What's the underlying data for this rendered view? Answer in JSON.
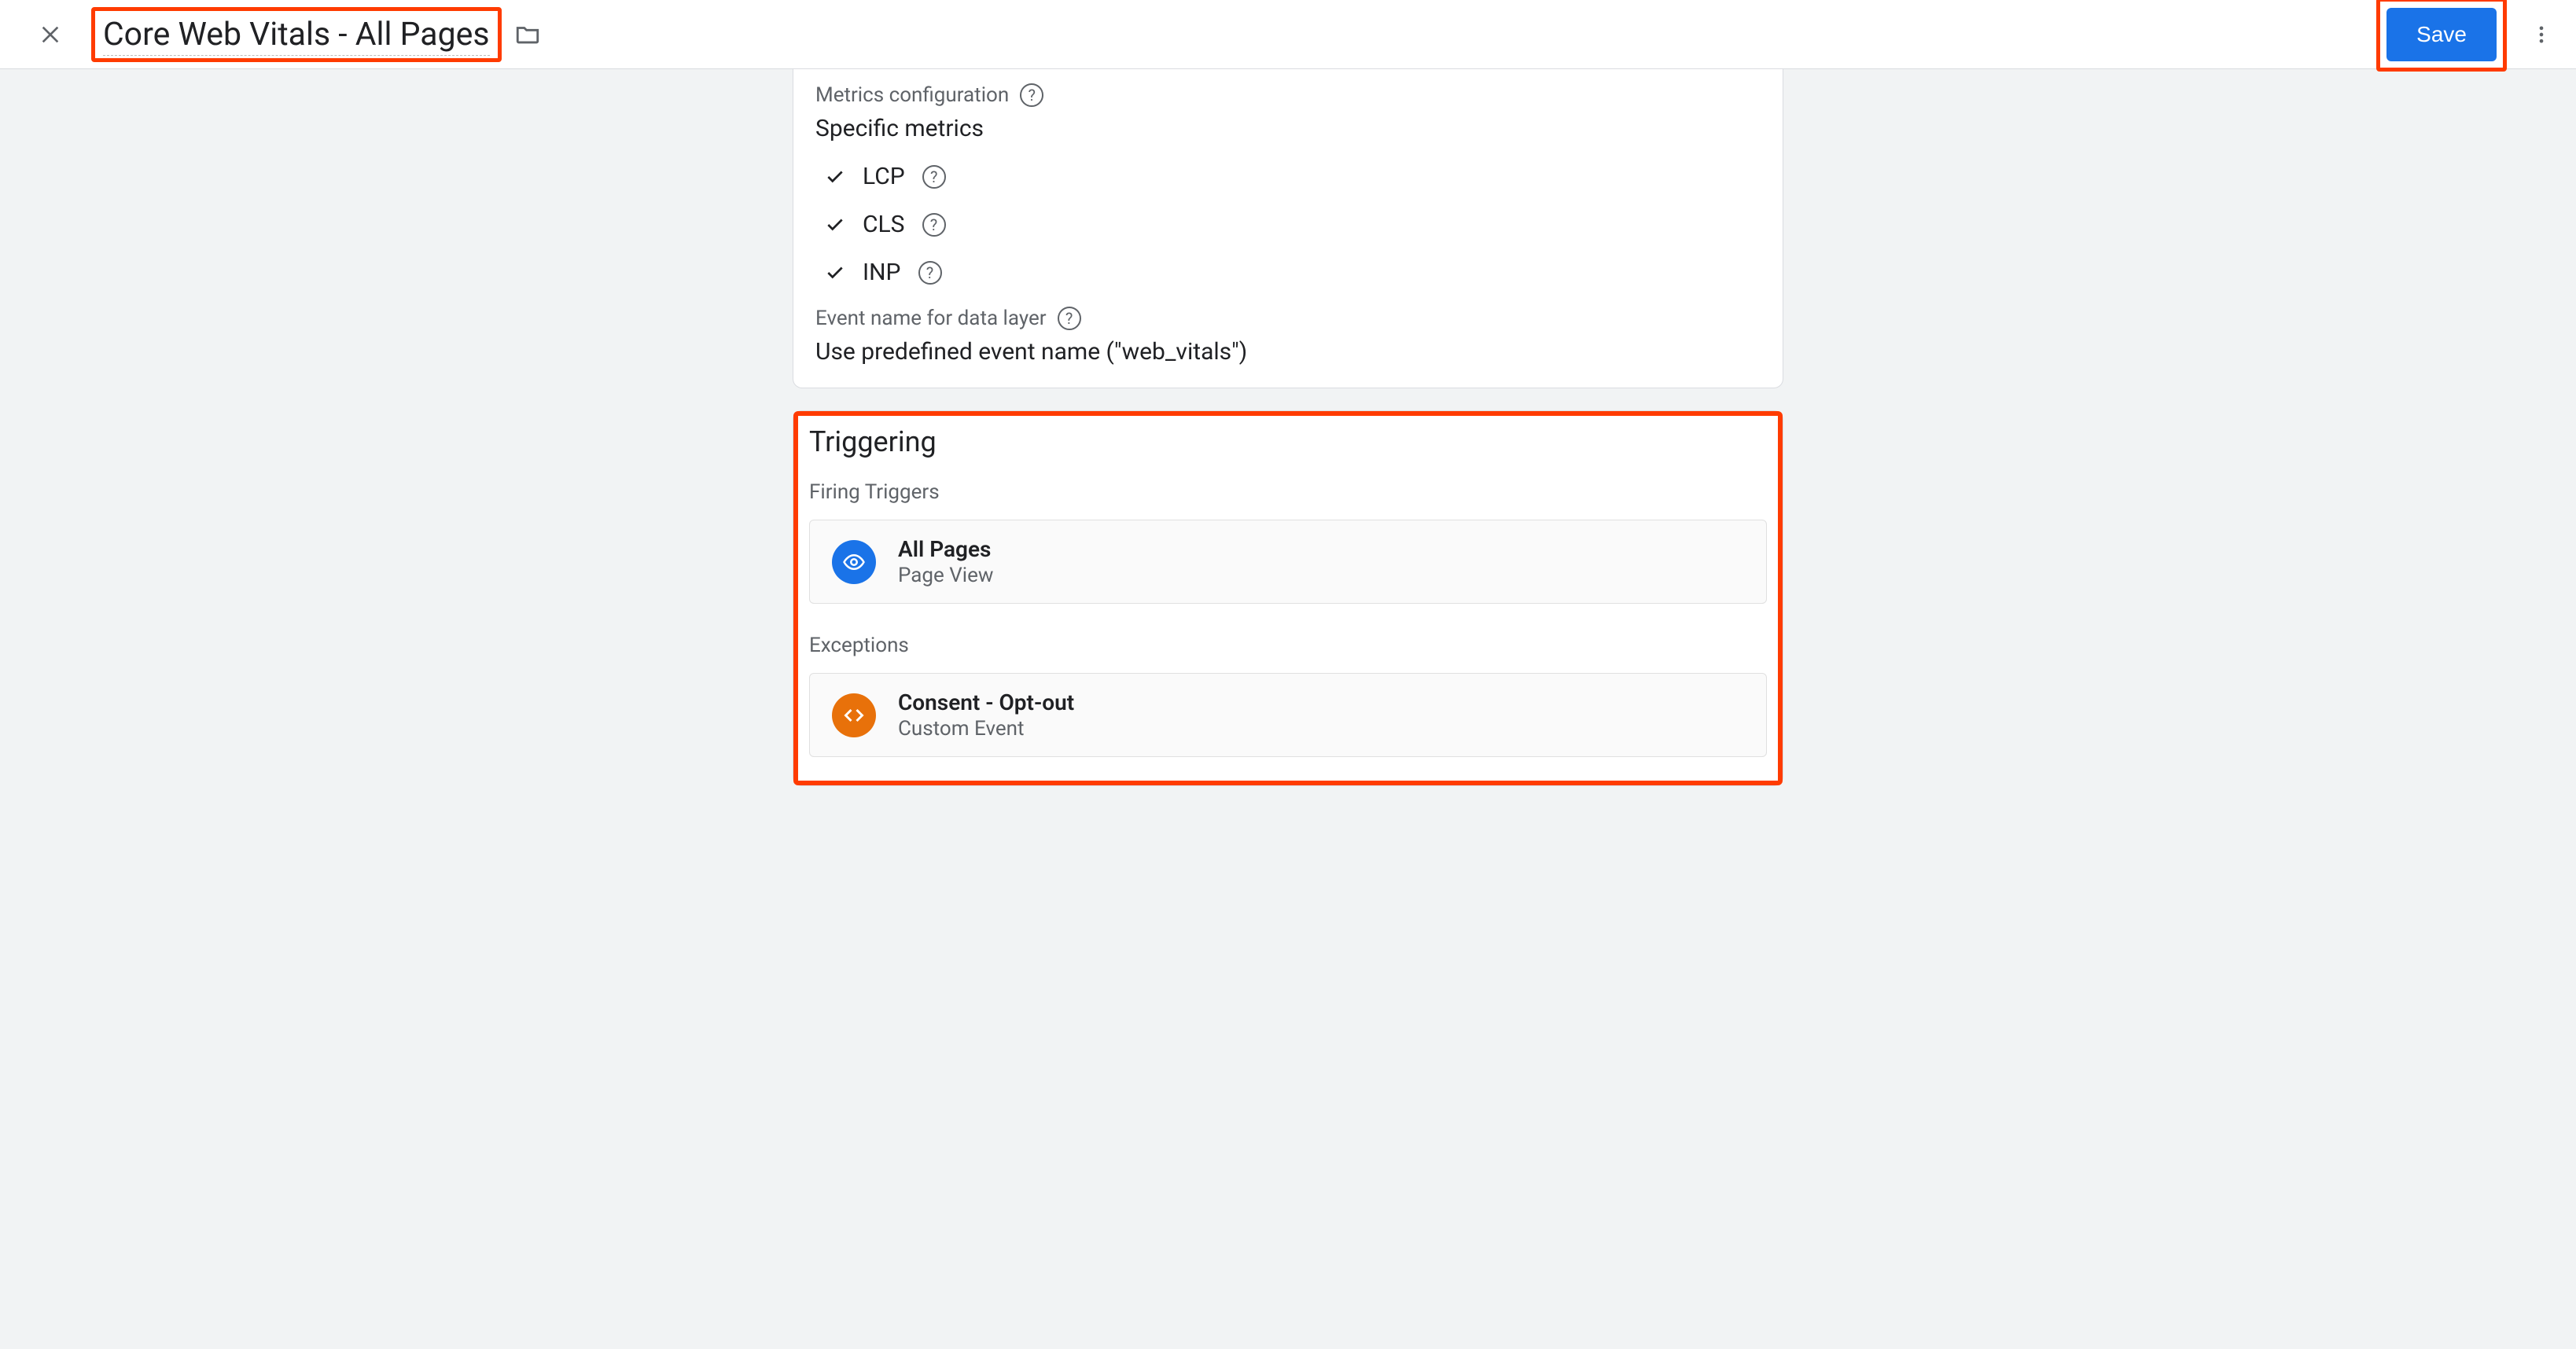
{
  "header": {
    "title": "Core Web Vitals - All Pages",
    "save_label": "Save"
  },
  "config": {
    "metrics_config_label": "Metrics configuration",
    "specific_metrics_label": "Specific metrics",
    "metrics": [
      {
        "name": "LCP"
      },
      {
        "name": "CLS"
      },
      {
        "name": "INP"
      }
    ],
    "event_name_label": "Event name for data layer",
    "event_name_value": "Use predefined event name (\"web_vitals\")"
  },
  "triggering": {
    "heading": "Triggering",
    "firing_label": "Firing Triggers",
    "firing": [
      {
        "name": "All Pages",
        "type": "Page View"
      }
    ],
    "exceptions_label": "Exceptions",
    "exceptions": [
      {
        "name": "Consent - Opt-out",
        "type": "Custom Event"
      }
    ]
  }
}
